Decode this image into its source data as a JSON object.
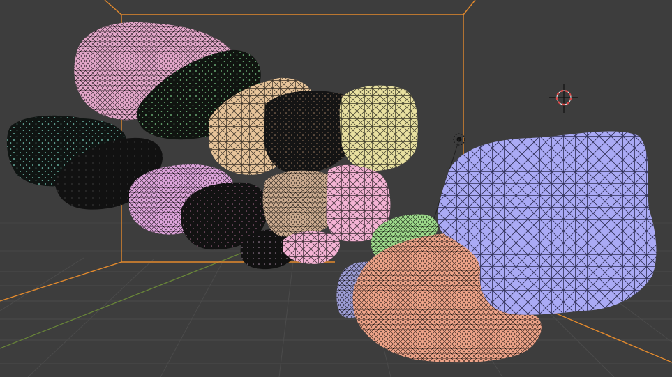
{
  "app": {
    "view": "3d-viewport",
    "shading": "wireframe"
  },
  "colors": {
    "background": "#3d3d3d",
    "grid": "#4a4a4a",
    "bounding_box": "#e38a2d",
    "x_axis": "#8e3b3b",
    "y_axis": "#6b8a38",
    "cursor_red": "#e04848",
    "cursor_white": "#f2f2f2"
  },
  "objects": [
    {
      "id": "mesh-pink-top",
      "color": "#e6a9cc",
      "wire": "#2b2229"
    },
    {
      "id": "mesh-dark-green-top",
      "color": "#101410",
      "wire": "#7fd18d"
    },
    {
      "id": "mesh-dark-cyan-left",
      "color": "#0f1412",
      "wire": "#7fd7c4"
    },
    {
      "id": "mesh-dark-left-lower",
      "color": "#111111",
      "wire": "#666666"
    },
    {
      "id": "mesh-pink-mid",
      "color": "#e0a6dd",
      "wire": "#2b2229"
    },
    {
      "id": "mesh-dark-center",
      "color": "#121212",
      "wire": "#b7749a"
    },
    {
      "id": "mesh-tan",
      "color": "#e7c49a",
      "wire": "#2a2219"
    },
    {
      "id": "mesh-dark-center-top",
      "color": "#141414",
      "wire": "#a07e64"
    },
    {
      "id": "mesh-yellow",
      "color": "#e8e0a0",
      "wire": "#262417"
    },
    {
      "id": "mesh-tan-lower",
      "color": "#cfae92",
      "wire": "#2a2219"
    },
    {
      "id": "mesh-light-pink",
      "color": "#f4b3d4",
      "wire": "#2b2229"
    },
    {
      "id": "mesh-dark-bottom",
      "color": "#111111",
      "wire": "#aa8fa8"
    },
    {
      "id": "mesh-green",
      "color": "#9fdc8c",
      "wire": "#1f2a1c"
    },
    {
      "id": "mesh-lavender-small",
      "color": "#9e9ed6",
      "wire": "#1f1f2a"
    },
    {
      "id": "mesh-salmon",
      "color": "#f0a58a",
      "wire": "#2a1c18"
    },
    {
      "id": "mesh-blue",
      "color": "#aaaaf5",
      "wire": "#1d1d33"
    }
  ]
}
